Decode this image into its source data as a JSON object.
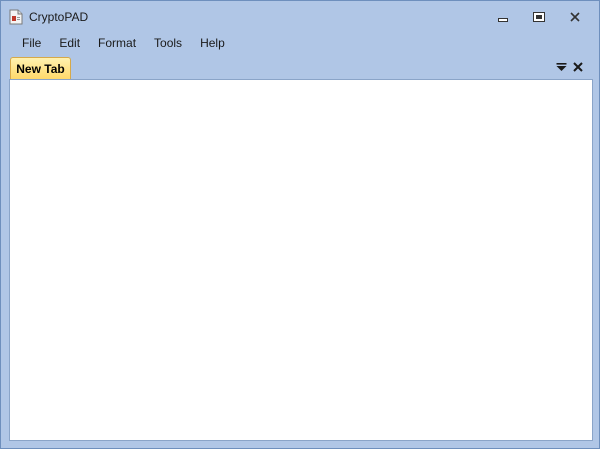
{
  "window": {
    "title": "CryptoPAD",
    "icon": "document-icon"
  },
  "controls": {
    "minimize_icon": "minimize-icon",
    "maximize_icon": "maximize-icon",
    "close_icon": "close-icon"
  },
  "menu": {
    "items": [
      "File",
      "Edit",
      "Format",
      "Tools",
      "Help"
    ]
  },
  "tabs": {
    "items": [
      {
        "label": "New Tab",
        "active": true
      }
    ],
    "dropdown_icon": "tab-list-dropdown-icon",
    "close_icon": "tab-close-icon"
  },
  "editor": {
    "content": ""
  },
  "colors": {
    "frame": "#b0c6e6",
    "active_tab": "#ffd86a",
    "editor_bg": "#ffffff"
  }
}
